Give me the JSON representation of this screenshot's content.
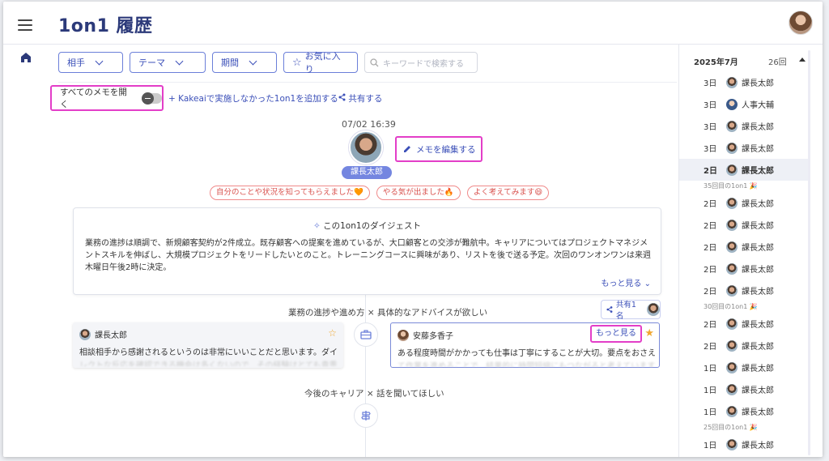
{
  "header": {
    "title": "1on1 履歴"
  },
  "filters": {
    "partner": "相手",
    "theme": "テーマ",
    "period": "期間",
    "favorite": "お気に入り",
    "search_placeholder": "キーワードで検索する"
  },
  "toolbar": {
    "open_all_memos": "すべてのメモを開く",
    "add_outside": "Kakeaiで実施しなかった1on1を追加する",
    "share": "共有する"
  },
  "session": {
    "datetime": "07/02 16:39",
    "name": "課長太郎",
    "edit_memo": "メモを編集する",
    "reactions": [
      "自分のことや状況を知ってもらえました🧡",
      "やる気が出ました🔥",
      "よく考えてみます😄"
    ],
    "digest_title": "この1on1のダイジェスト",
    "digest_body": "業務の進捗は順調で、新規顧客契約が2件成立。既存顧客への提案を進めているが、大口顧客との交渉が難航中。キャリアについてはプロジェクトマネジメントスキルを伸ばし、大規模プロジェクトをリードしたいとのこと。トレーニングコースに興味があり、リストを後で送る予定。次回のワンオンワンは来週木曜日午後2時に決定。",
    "digest_more": "もっと見る",
    "topic1": "業務の進捗や進め方 × 具体的なアドバイスが欲しい",
    "share_count": "共有1名",
    "left_card": {
      "name": "課長太郎",
      "text": "相談相手から感謝されるというのは非常にいいことだと思います。ダイ",
      "text2": "レクトな反応を確認できる機会は多くないので、その経験はとても貴重です。"
    },
    "right_card": {
      "name": "安藤多香子",
      "more": "もっと見る",
      "text": "ある程度時間がかかっても仕事は丁寧にすることが大切。要点をおさえ",
      "text2": "て作業を進めることで、結果的に時間短縮にもつながると考えています。"
    },
    "topic2": "今後のキャリア × 話を聞いてほしい"
  },
  "history": {
    "month": "2025年7月",
    "count": "26回",
    "items": [
      {
        "day": "3日",
        "name": "課長太郎"
      },
      {
        "day": "3日",
        "name": "人事大輔"
      },
      {
        "day": "3日",
        "name": "課長太郎"
      },
      {
        "day": "3日",
        "name": "課長太郎"
      },
      {
        "day": "2日",
        "name": "課長太郎"
      }
    ],
    "sep1": "35回目の1on1 🎉",
    "items2": [
      {
        "day": "2日",
        "name": "課長太郎"
      },
      {
        "day": "2日",
        "name": "課長太郎"
      },
      {
        "day": "2日",
        "name": "課長太郎"
      },
      {
        "day": "2日",
        "name": "課長太郎"
      },
      {
        "day": "2日",
        "name": "課長太郎"
      }
    ],
    "sep2": "30回目の1on1 🎉",
    "items3": [
      {
        "day": "2日",
        "name": "課長太郎"
      },
      {
        "day": "2日",
        "name": "課長太郎"
      },
      {
        "day": "1日",
        "name": "課長太郎"
      },
      {
        "day": "1日",
        "name": "課長太郎"
      },
      {
        "day": "1日",
        "name": "課長太郎"
      }
    ],
    "sep3": "25回目の1on1 🎉",
    "items4": [
      {
        "day": "1日",
        "name": "課長太郎"
      }
    ]
  },
  "colors": {
    "accent": "#3b4fb8",
    "highlight": "#e33ec8",
    "title": "#2c3a7a",
    "star": "#f0a830"
  }
}
